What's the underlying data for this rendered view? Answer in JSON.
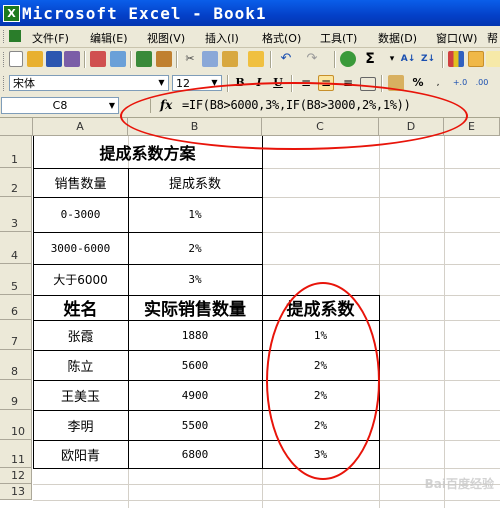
{
  "window": {
    "title": "Microsoft Excel - Book1"
  },
  "menu": [
    "文件(F)",
    "编辑(E)",
    "视图(V)",
    "插入(I)",
    "格式(O)",
    "工具(T)",
    "数据(D)",
    "窗口(W)",
    "帮"
  ],
  "format_toolbar": {
    "font": "宋体",
    "size": "12",
    "bold": "B",
    "italic": "I",
    "underline": "U",
    "percent": "%"
  },
  "formula_bar": {
    "name_box": "C8",
    "fx": "fx",
    "formula": "=IF(B8>6000,3%,IF(B8>3000,2%,1%))"
  },
  "columns": [
    "A",
    "B",
    "C",
    "D",
    "E"
  ],
  "rows": [
    "1",
    "2",
    "3",
    "4",
    "5",
    "6",
    "7",
    "8",
    "9",
    "10",
    "11",
    "12",
    "13"
  ],
  "sheet": {
    "scheme_title": "提成系数方案",
    "scheme_headers": [
      "销售数量",
      "提成系数"
    ],
    "scheme_rows": [
      [
        "0-3000",
        "1%"
      ],
      [
        "3000-6000",
        "2%"
      ],
      [
        "大于6000",
        "3%"
      ]
    ],
    "table_headers": [
      "姓名",
      "实际销售数量",
      "提成系数"
    ],
    "table_rows": [
      [
        "张霞",
        "1880",
        "1%"
      ],
      [
        "陈立",
        "5600",
        "2%"
      ],
      [
        "王美玉",
        "4900",
        "2%"
      ],
      [
        "李明",
        "5500",
        "2%"
      ],
      [
        "欧阳青",
        "6800",
        "3%"
      ]
    ]
  },
  "annotations": {
    "color": "#e8140a"
  },
  "watermark": "Bai百度经验"
}
